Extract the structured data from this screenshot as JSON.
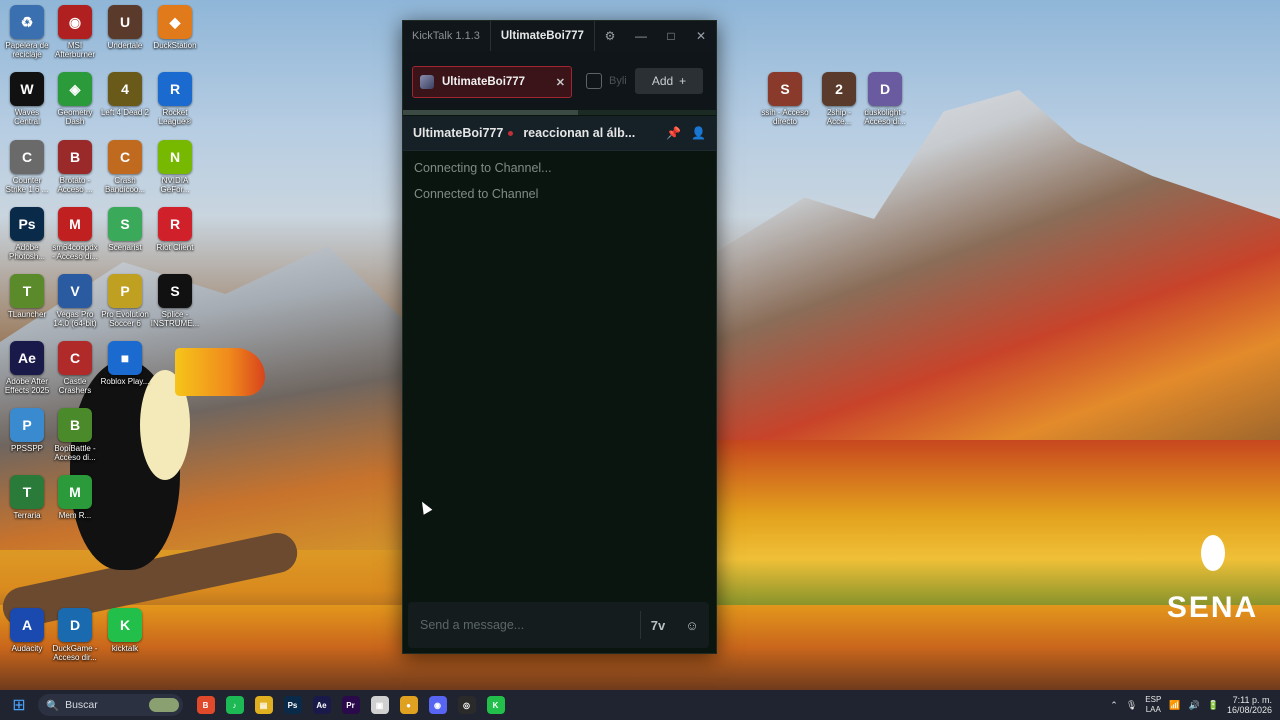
{
  "desktop": {
    "icons": [
      {
        "label": "Papelera de\nreciclaje",
        "glyph": "♻",
        "color": "#3a6fb0"
      },
      {
        "label": "MSI\nAfterburner",
        "glyph": "◉",
        "color": "#b02020"
      },
      {
        "label": "Undertale",
        "glyph": "U",
        "color": "#5a3a2a"
      },
      {
        "label": "DuckStation",
        "glyph": "◆",
        "color": "#e07a1a"
      },
      {
        "label": "Waves\nCentral",
        "glyph": "W",
        "color": "#111111"
      },
      {
        "label": "Geometry\nDash",
        "glyph": "◈",
        "color": "#2a9a3a"
      },
      {
        "label": "Left 4 Dead 2",
        "glyph": "4",
        "color": "#6a5a1a"
      },
      {
        "label": "Rocket\nLeague®",
        "glyph": "R",
        "color": "#1a6ad0"
      },
      {
        "label": "Counter\nStrike 1.6 ...",
        "glyph": "C",
        "color": "#6a6a6a"
      },
      {
        "label": "Brotato -\nAcceso ...",
        "glyph": "B",
        "color": "#9a2a2a"
      },
      {
        "label": "Crash\nBandicoo...",
        "glyph": "C",
        "color": "#c06a20"
      },
      {
        "label": "NVIDIA\nGeFor...",
        "glyph": "N",
        "color": "#76b900"
      },
      {
        "label": "Adobe\nPhotosh...",
        "glyph": "Ps",
        "color": "#0a2a4a"
      },
      {
        "label": "sm64coopdx\n- Acceso di...",
        "glyph": "M",
        "color": "#c02020"
      },
      {
        "label": "Scenarist",
        "glyph": "S",
        "color": "#3aaa5a"
      },
      {
        "label": "Riot Client",
        "glyph": "R",
        "color": "#d0202a"
      },
      {
        "label": "TLauncher",
        "glyph": "T",
        "color": "#5a8a2a"
      },
      {
        "label": "Vegas Pro\n14.0 (64-bit)",
        "glyph": "V",
        "color": "#2a5aa0"
      },
      {
        "label": "Pro Evolution\nSoccer 6",
        "glyph": "P",
        "color": "#c0a020"
      },
      {
        "label": "Splice -\nINSTRUME...",
        "glyph": "S",
        "color": "#111111"
      },
      {
        "label": "Adobe After\nEffects 2025",
        "glyph": "Ae",
        "color": "#1a1a4a"
      },
      {
        "label": "Castle\nCrashers",
        "glyph": "C",
        "color": "#b02a2a"
      },
      {
        "label": "Roblox Play...",
        "glyph": "■",
        "color": "#1a6ad0"
      },
      {
        "label": "PPSSPP",
        "glyph": "P",
        "color": "#3a8ad0"
      },
      {
        "label": "BopiBattle -\nAcceso di...",
        "glyph": "B",
        "color": "#4a8a2a"
      },
      {
        "label": "Terraria",
        "glyph": "T",
        "color": "#2a7a3a"
      },
      {
        "label": "Mem R...",
        "glyph": "M",
        "color": "#2a9a3a"
      },
      {
        "label": "Audacity",
        "glyph": "A",
        "color": "#1a4ab0"
      },
      {
        "label": "DuckGame -\nAcceso dir...",
        "glyph": "D",
        "color": "#1a6ab0"
      },
      {
        "label": "kicktalk",
        "glyph": "K",
        "color": "#22c04a"
      },
      {
        "label": "ssih - Acceso\ndirecto",
        "glyph": "S",
        "color": "#8a3a2a"
      },
      {
        "label": "2ship -\nAcce...",
        "glyph": "2",
        "color": "#5a3a2a"
      },
      {
        "label": "duskolight -\nAcceso di...",
        "glyph": "D",
        "color": "#6a5aa0"
      }
    ]
  },
  "window": {
    "app_title": "KickTalk 1.1.3",
    "user": "UltimateBoi777",
    "controls": {
      "settings": "⚙",
      "minimize": "—",
      "maximize": "□",
      "close": "✕"
    }
  },
  "tabs": {
    "active": {
      "name": "UltimateBoi777",
      "close": "✕"
    },
    "second": {
      "name": "Byli"
    },
    "add_label": "Add",
    "add_icon": "+",
    "progress": 0.56
  },
  "channel": {
    "name": "UltimateBoi777",
    "topic": "reaccionan al álb...",
    "icons": {
      "pin": "📌",
      "user": "👤"
    }
  },
  "messages": [
    "Connecting to Channel...",
    "Connected to Channel"
  ],
  "composer": {
    "placeholder": "Send a message...",
    "emote_button": "7v",
    "emoji_button": "☺"
  },
  "logo": {
    "text": "SENA"
  },
  "taskbar": {
    "search_placeholder": "Buscar",
    "apps": [
      {
        "name": "brave",
        "glyph": "B",
        "color": "#e04a2a"
      },
      {
        "name": "spotify",
        "glyph": "♪",
        "color": "#1db954"
      },
      {
        "name": "file-explorer",
        "glyph": "▤",
        "color": "#e0b020"
      },
      {
        "name": "photoshop",
        "glyph": "Ps",
        "color": "#0a2a4a"
      },
      {
        "name": "after-effects",
        "glyph": "Ae",
        "color": "#1a1a4a"
      },
      {
        "name": "premiere",
        "glyph": "Pr",
        "color": "#2a0a4a"
      },
      {
        "name": "store",
        "glyph": "▣",
        "color": "#d0d0d0"
      },
      {
        "name": "chrome",
        "glyph": "●",
        "color": "#e0a020"
      },
      {
        "name": "discord",
        "glyph": "◉",
        "color": "#5865f2"
      },
      {
        "name": "obs",
        "glyph": "◎",
        "color": "#2a2a2a"
      },
      {
        "name": "kicktalk",
        "glyph": "K",
        "color": "#22c04a"
      }
    ],
    "language": "ESP",
    "language_sub": "LAA",
    "time": "7:11 p. m.",
    "date": "16/08/2026"
  }
}
